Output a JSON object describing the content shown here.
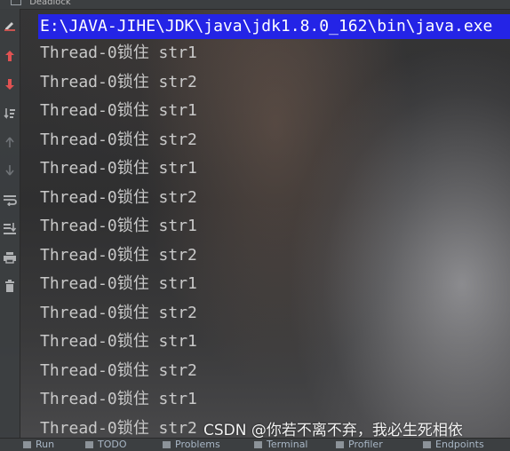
{
  "window": {
    "run_tab_label": "Deadlock"
  },
  "toolbar": {
    "buttons": [
      {
        "name": "edit-config-icon",
        "color": "#c75450"
      },
      {
        "name": "arrow-up-icon",
        "color": "#e05252"
      },
      {
        "name": "arrow-down-icon",
        "color": "#e05252"
      },
      {
        "name": "sort-icon",
        "color": "#afb1b3"
      },
      {
        "name": "scroll-up-icon",
        "color": "#7a7e82"
      },
      {
        "name": "scroll-down-icon",
        "color": "#7a7e82"
      },
      {
        "name": "soft-wrap-icon",
        "color": "#afb1b3"
      },
      {
        "name": "scroll-to-end-icon",
        "color": "#afb1b3"
      },
      {
        "name": "print-icon",
        "color": "#afb1b3"
      },
      {
        "name": "trash-icon",
        "color": "#afb1b3"
      }
    ]
  },
  "console": {
    "command_line": "E:\\JAVA-JIHE\\JDK\\java\\jdk1.8.0_162\\bin\\java.exe",
    "command_bg": "#2424e6",
    "lines": [
      "Thread-0锁住 str1",
      "Thread-0锁住 str2",
      "Thread-0锁住 str1",
      "Thread-0锁住 str2",
      "Thread-0锁住 str1",
      "Thread-0锁住 str2",
      "Thread-0锁住 str1",
      "Thread-0锁住 str2",
      "Thread-0锁住 str1",
      "Thread-0锁住 str2",
      "Thread-0锁住 str1",
      "Thread-0锁住 str2",
      "Thread-0锁住 str1",
      "Thread-0锁住 str2"
    ]
  },
  "watermark": {
    "text": "CSDN @你若不离不弃，我必生死相依"
  },
  "bottom_bar": {
    "items": [
      {
        "name": "run-tab",
        "label": "Run"
      },
      {
        "name": "todo-tab",
        "label": "TODO"
      },
      {
        "name": "problems-tab",
        "label": "Problems"
      },
      {
        "name": "terminal-tab",
        "label": "Terminal"
      },
      {
        "name": "profiler-tab",
        "label": "Profiler"
      },
      {
        "name": "endpoints-tab",
        "label": "Endpoints"
      }
    ]
  }
}
